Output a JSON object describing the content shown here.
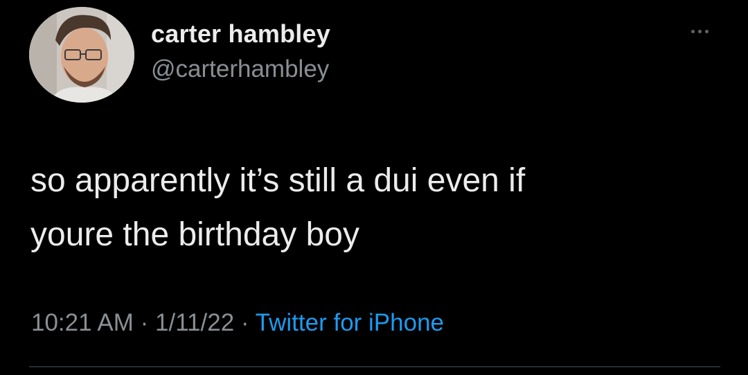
{
  "author": {
    "display_name": "carter hambley",
    "handle": "@carterhambley",
    "avatar_icon": "profile-photo"
  },
  "tweet": {
    "text": "so apparently it’s still a dui even if\nyoure the birthday boy"
  },
  "meta": {
    "time": "10:21 AM",
    "sep1": " · ",
    "date": "1/11/22",
    "sep2": " · ",
    "source": "Twitter for iPhone"
  },
  "colors": {
    "background": "#000000",
    "primary_text": "#ececec",
    "secondary_text": "#8a8f94",
    "link": "#1d9bf0"
  }
}
